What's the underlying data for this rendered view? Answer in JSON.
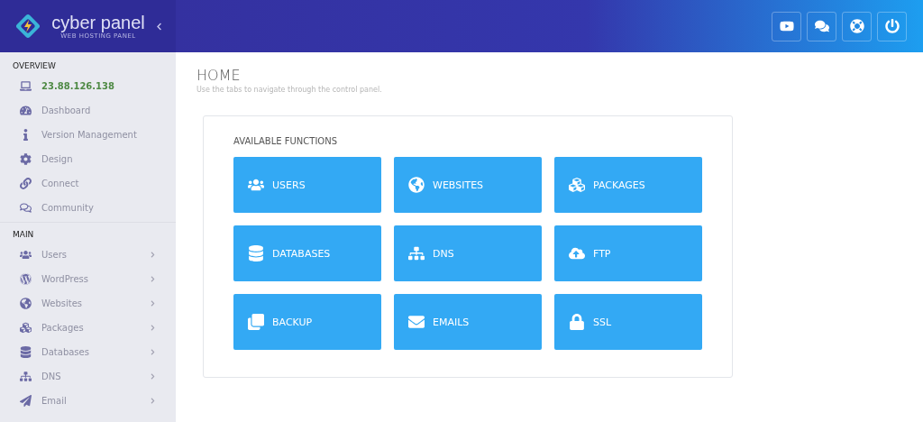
{
  "brand": {
    "name": "cyber panel",
    "tagline": "WEB HOSTING PANEL"
  },
  "sidebar": {
    "sections": [
      {
        "title": "OVERVIEW",
        "items": [
          {
            "label": "23.88.126.138",
            "kind": "address",
            "has_submenu": false
          },
          {
            "label": "Dashboard",
            "kind": "link",
            "has_submenu": false
          },
          {
            "label": "Version Management",
            "kind": "link",
            "has_submenu": false
          },
          {
            "label": "Design",
            "kind": "link",
            "has_submenu": false
          },
          {
            "label": "Connect",
            "kind": "link",
            "has_submenu": false
          },
          {
            "label": "Community",
            "kind": "link",
            "has_submenu": false
          }
        ]
      },
      {
        "title": "MAIN",
        "items": [
          {
            "label": "Users",
            "kind": "link",
            "has_submenu": true
          },
          {
            "label": "WordPress",
            "kind": "link",
            "has_submenu": true
          },
          {
            "label": "Websites",
            "kind": "link",
            "has_submenu": true
          },
          {
            "label": "Packages",
            "kind": "link",
            "has_submenu": true
          },
          {
            "label": "Databases",
            "kind": "link",
            "has_submenu": true
          },
          {
            "label": "DNS",
            "kind": "link",
            "has_submenu": true
          },
          {
            "label": "Email",
            "kind": "link",
            "has_submenu": true
          }
        ]
      }
    ]
  },
  "page": {
    "title": "HOME",
    "subtitle": "Use the tabs to navigate through the control panel."
  },
  "functions": {
    "title": "AVAILABLE FUNCTIONS",
    "tiles": [
      {
        "label": "USERS"
      },
      {
        "label": "WEBSITES"
      },
      {
        "label": "PACKAGES"
      },
      {
        "label": "DATABASES"
      },
      {
        "label": "DNS"
      },
      {
        "label": "FTP"
      },
      {
        "label": "BACKUP"
      },
      {
        "label": "EMAILS"
      },
      {
        "label": "SSL"
      }
    ]
  }
}
